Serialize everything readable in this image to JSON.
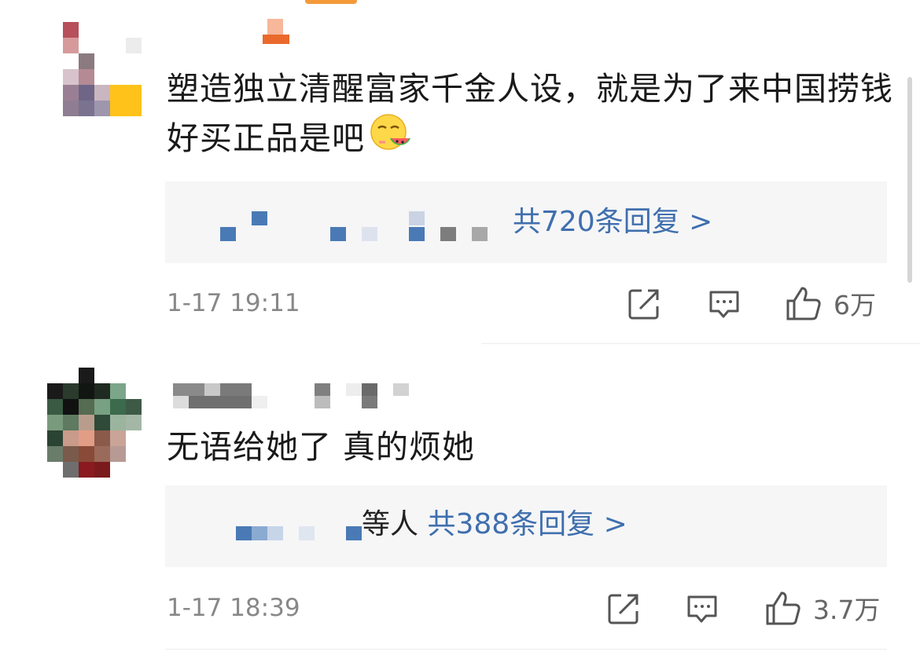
{
  "comments": [
    {
      "text": "塑造独立清醒富家千金人设，就是为了来中国捞钱好买正品是吧",
      "emoji_icon": "watermelon-smirk-emoji",
      "replies_summary": "共720条回复 >",
      "time": "1-17 19:11",
      "likes": "6万"
    },
    {
      "text": "无语给她了 真的烦她",
      "replies_prefix": "等人",
      "replies_summary": "共388条回复 >",
      "time": "1-17 18:39",
      "likes": "3.7万"
    }
  ],
  "icons": {
    "share": "share-icon",
    "comment": "comment-icon",
    "like": "thumbs-up-icon"
  },
  "colors": {
    "link": "#3f6fae",
    "reply_bg": "#f6f6f7",
    "meta": "#888888",
    "accent": "#f39a3a"
  }
}
